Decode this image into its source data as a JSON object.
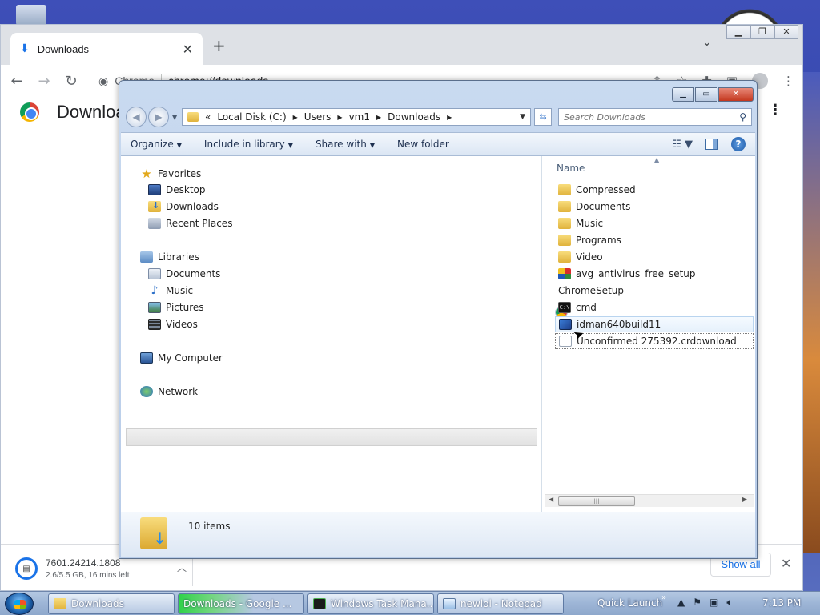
{
  "chrome": {
    "tab_title": "Downloads",
    "site_label": "Chrome",
    "url": "chrome://downloads",
    "page_title": "Downloads",
    "shelf": {
      "file_name": "7601.24214.1808",
      "file_status": "2.6/5.5 GB, 16 mins left",
      "show_all": "Show all"
    }
  },
  "explorer": {
    "address": {
      "overflow": "«",
      "crumbs": [
        "Local Disk (C:)",
        "Users",
        "vm1",
        "Downloads"
      ]
    },
    "search_placeholder": "Search Downloads",
    "toolbar": {
      "organize": "Organize",
      "include_in_library": "Include in library",
      "share_with": "Share with",
      "new_folder": "New folder"
    },
    "nav": {
      "favorites": "Favorites",
      "desktop": "Desktop",
      "downloads": "Downloads",
      "recent_places": "Recent Places",
      "libraries": "Libraries",
      "documents": "Documents",
      "music": "Music",
      "pictures": "Pictures",
      "videos": "Videos",
      "my_computer": "My Computer",
      "network": "Network"
    },
    "column_name": "Name",
    "files": [
      {
        "name": "Compressed",
        "icon": "folder-icon"
      },
      {
        "name": "Documents",
        "icon": "folder-icon"
      },
      {
        "name": "Music",
        "icon": "folder-icon"
      },
      {
        "name": "Programs",
        "icon": "folder-icon"
      },
      {
        "name": "Video",
        "icon": "folder-icon"
      },
      {
        "name": "avg_antivirus_free_setup",
        "icon": "avg-installer-icon"
      },
      {
        "name": "ChromeSetup",
        "icon": "chrome-installer-icon"
      },
      {
        "name": "cmd",
        "icon": "cmd-icon"
      },
      {
        "name": "idman640build11",
        "icon": "idm-installer-icon"
      },
      {
        "name": "Unconfirmed 275392.crdownload",
        "icon": "blank-file-icon"
      }
    ],
    "item_count": "10 items"
  },
  "taskbar": {
    "buttons": [
      "Downloads",
      "Downloads - Google ...",
      "Windows Task Mana...",
      "newlol - Notepad"
    ],
    "quick_launch": "Quick Launch",
    "time": "7:13 PM"
  }
}
